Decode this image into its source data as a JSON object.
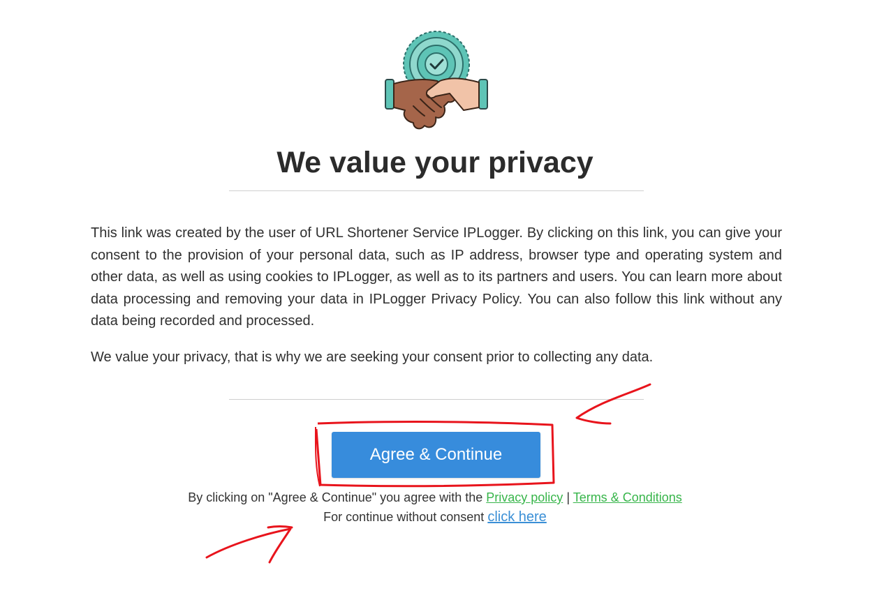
{
  "logo": {
    "icon": "handshake-badge-icon"
  },
  "title": "We value your privacy",
  "paragraphs": {
    "p1": "This link was created by the user of URL Shortener Service IPLogger. By clicking on this link, you can give your consent to the provision of your personal data, such as IP address, browser type and operating system and other data, as well as using cookies to IPLogger, as well as to its partners and users. You can learn more about data processing and removing your data in IPLogger Privacy Policy. You can also follow this link without any data being recorded and processed.",
    "p2": "We value your privacy, that is why we are seeking your consent prior to collecting any data."
  },
  "agree_button": {
    "label": "Agree & Continue"
  },
  "consent_note": {
    "prefix": "By clicking on \"Agree & Continue\" you agree with the",
    "privacy_link": "Privacy policy",
    "separator": "|",
    "terms_link": "Terms & Conditions"
  },
  "no_consent_note": {
    "prefix": "For continue without consent",
    "link": "click here"
  },
  "colors": {
    "button": "#378cdc",
    "green_link": "#37b54a",
    "blue_link": "#3a8fd6",
    "annotation": "#e8141c"
  }
}
